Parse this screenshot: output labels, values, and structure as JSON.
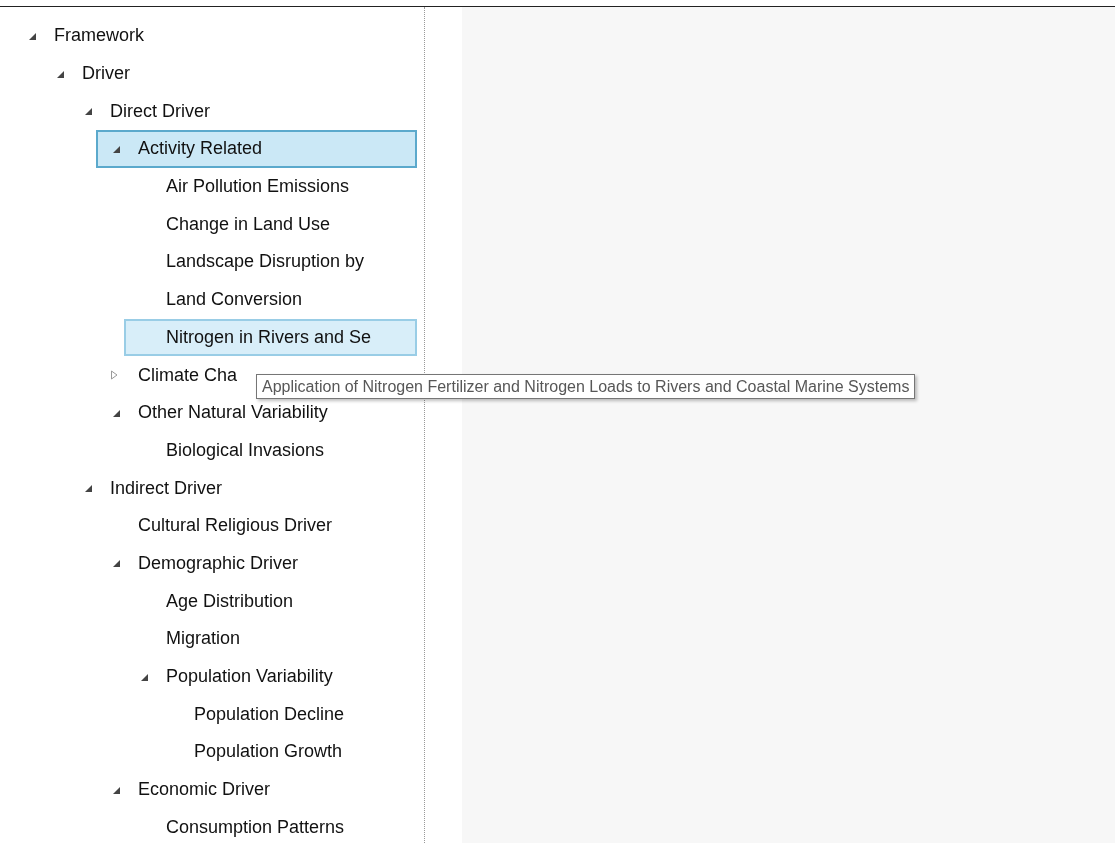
{
  "tree": {
    "items": [
      {
        "label": "Framework",
        "expanded": true,
        "selected": false,
        "hovered": false,
        "children": [
          {
            "label": "Driver",
            "expanded": true,
            "selected": false,
            "hovered": false,
            "children": [
              {
                "label": "Direct Driver",
                "expanded": true,
                "selected": false,
                "hovered": false,
                "children": [
                  {
                    "label": "Activity Related",
                    "expanded": true,
                    "selected": true,
                    "hovered": false,
                    "children": [
                      {
                        "label": "Air Pollution Emissions",
                        "selected": false,
                        "hovered": false
                      },
                      {
                        "label": "Change in Land Use",
                        "selected": false,
                        "hovered": false
                      },
                      {
                        "label": "Landscape Disruption by",
                        "selected": false,
                        "hovered": false
                      },
                      {
                        "label": "Land Conversion",
                        "selected": false,
                        "hovered": false
                      },
                      {
                        "label": "Nitrogen in Rivers and Se",
                        "selected": false,
                        "hovered": true
                      }
                    ]
                  },
                  {
                    "label": "Climate Cha",
                    "expanded": false,
                    "selected": false,
                    "hovered": false
                  },
                  {
                    "label": "Other Natural Variability",
                    "expanded": true,
                    "selected": false,
                    "hovered": false,
                    "children": [
                      {
                        "label": "Biological Invasions",
                        "selected": false,
                        "hovered": false
                      }
                    ]
                  }
                ]
              },
              {
                "label": "Indirect Driver",
                "expanded": true,
                "selected": false,
                "hovered": false,
                "children": [
                  {
                    "label": "Cultural Religious Driver",
                    "selected": false,
                    "hovered": false
                  },
                  {
                    "label": "Demographic Driver",
                    "expanded": true,
                    "selected": false,
                    "hovered": false,
                    "children": [
                      {
                        "label": "Age Distribution",
                        "selected": false,
                        "hovered": false
                      },
                      {
                        "label": "Migration",
                        "selected": false,
                        "hovered": false
                      },
                      {
                        "label": "Population Variability",
                        "expanded": true,
                        "selected": false,
                        "hovered": false,
                        "children": [
                          {
                            "label": "Population Decline",
                            "selected": false,
                            "hovered": false
                          },
                          {
                            "label": "Population Growth",
                            "selected": false,
                            "hovered": false
                          }
                        ]
                      }
                    ]
                  },
                  {
                    "label": "Economic Driver",
                    "expanded": true,
                    "selected": false,
                    "hovered": false,
                    "children": [
                      {
                        "label": "Consumption Patterns",
                        "selected": false,
                        "hovered": false
                      }
                    ]
                  }
                ]
              }
            ]
          }
        ]
      }
    ]
  },
  "tooltip": {
    "text": "Application of Nitrogen Fertilizer and Nitrogen Loads to Rivers and Coastal Marine Systems"
  }
}
